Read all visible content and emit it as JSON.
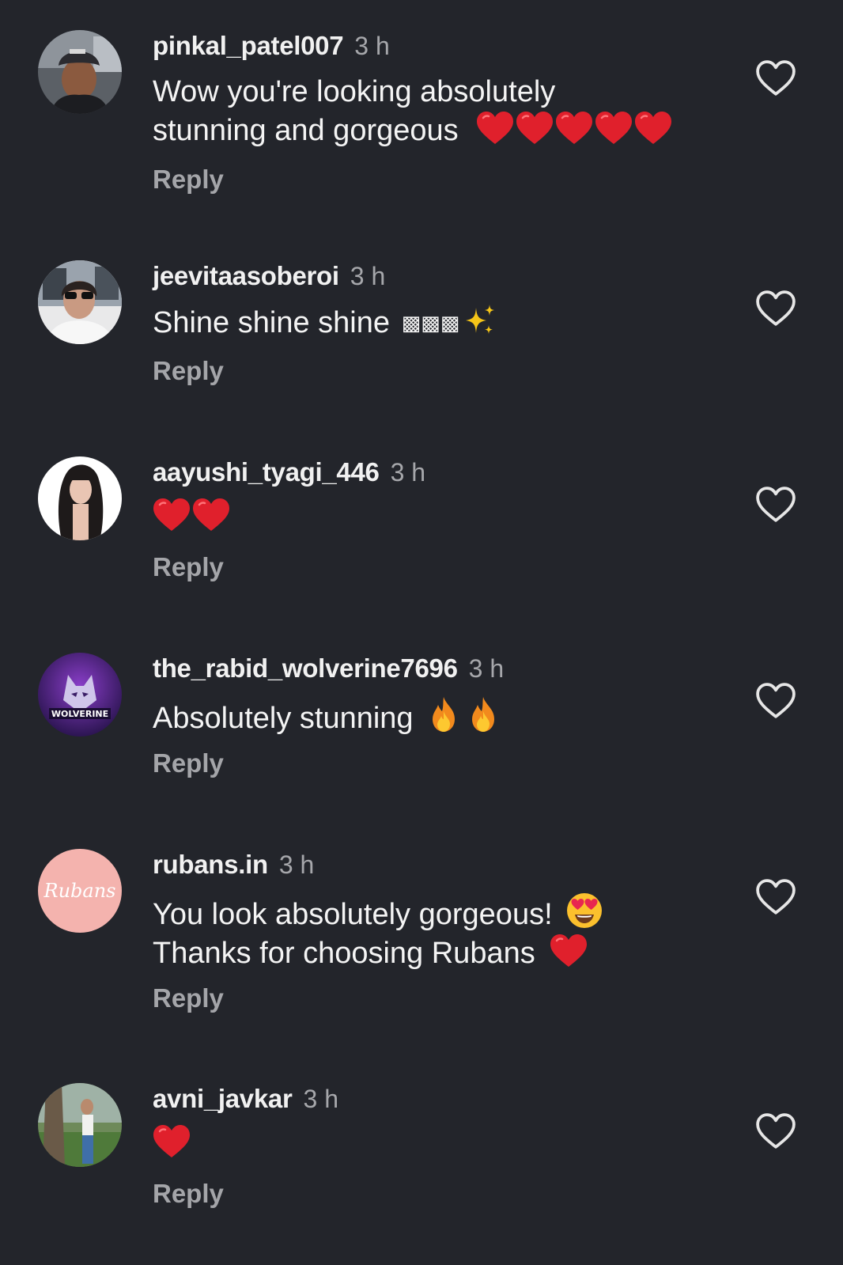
{
  "comments": [
    {
      "username": "pinkal_patel007",
      "time": "3 h",
      "line1": "Wow you're looking absolutely",
      "line2": "stunning and gorgeous",
      "emojis": [
        "red-heart",
        "red-heart",
        "red-heart",
        "red-heart",
        "red-heart"
      ],
      "reply": "Reply"
    },
    {
      "username": "jeevitaasoberoi",
      "time": "3 h",
      "line1": "Shine shine shine",
      "missing_glyphs": "▩▩▩",
      "emojis": [
        "sparkles"
      ],
      "reply": "Reply"
    },
    {
      "username": "aayushi_tyagi_446",
      "time": "3 h",
      "emojis": [
        "red-heart",
        "red-heart"
      ],
      "reply": "Reply"
    },
    {
      "username": "the_rabid_wolverine7696",
      "time": "3 h",
      "line1": "Absolutely stunning",
      "emojis": [
        "fire",
        "fire"
      ],
      "reply": "Reply"
    },
    {
      "username": "rubans.in",
      "time": "3 h",
      "line1": "You look absolutely gorgeous!",
      "line1_emoji": "heart-eyes-face",
      "line2": "Thanks for choosing Rubans",
      "line2_emoji": "red-heart",
      "avatar_text": "Rubans",
      "reply": "Reply"
    },
    {
      "username": "avni_javkar",
      "time": "3 h",
      "emojis": [
        "red-heart"
      ],
      "reply": "Reply"
    }
  ],
  "icons": {
    "like": "heart-outline-icon",
    "heart_emoji": "red-heart",
    "sparkles_emoji": "sparkles",
    "fire_emoji": "fire",
    "heart_eyes_emoji": "heart-eyes-face"
  },
  "colors": {
    "background": "#23252b",
    "text": "#f4f4f4",
    "secondary": "#a6a7ab",
    "heart": "#e0202c",
    "rubans_avatar": "#f4b3ae"
  }
}
